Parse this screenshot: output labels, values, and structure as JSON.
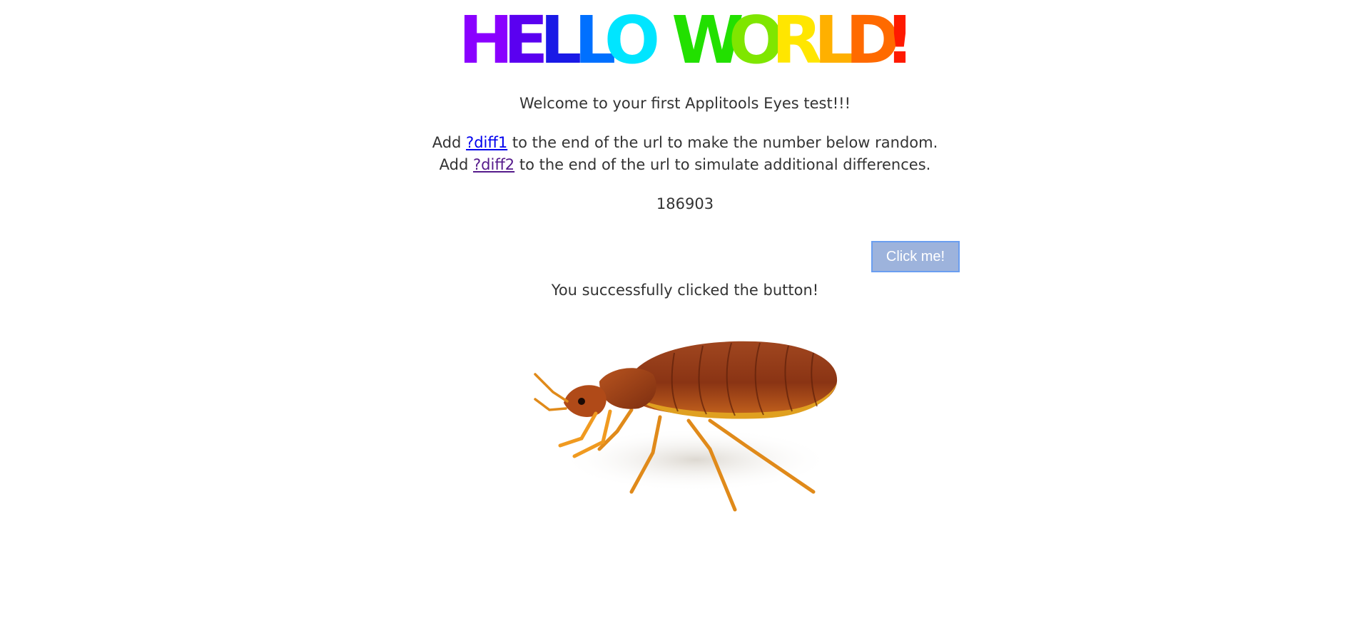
{
  "heading": {
    "letters": [
      {
        "char": "H",
        "color": "#8a00ff"
      },
      {
        "char": "E",
        "color": "#5a00f0"
      },
      {
        "char": "L",
        "color": "#1a1ae6"
      },
      {
        "char": "L",
        "color": "#0070ff"
      },
      {
        "char": "O",
        "color": "#00e5ff"
      },
      {
        "char": " ",
        "color": "#ffffff"
      },
      {
        "char": "W",
        "color": "#22e000"
      },
      {
        "char": "O",
        "color": "#7fe600"
      },
      {
        "char": "R",
        "color": "#ffe600"
      },
      {
        "char": "L",
        "color": "#ffb000"
      },
      {
        "char": "D",
        "color": "#ff6a00"
      },
      {
        "char": "!",
        "color": "#ff1a00"
      }
    ]
  },
  "welcome_text": "Welcome to your first Applitools Eyes test!!!",
  "diff1_line": {
    "prefix": "Add ",
    "link": "?diff1",
    "suffix": " to the end of the url to make the number below random."
  },
  "diff2_line": {
    "prefix": "Add ",
    "link": "?diff2",
    "suffix": " to the end of the url to simulate additional differences."
  },
  "random_number": "186903",
  "button_label": "Click me!",
  "click_result": "You successfully clicked the button!",
  "colors": {
    "link": "#0000ee",
    "link_visited": "#551a8b",
    "button_bg": "#9db3dc",
    "button_border": "#6a9ef0"
  }
}
